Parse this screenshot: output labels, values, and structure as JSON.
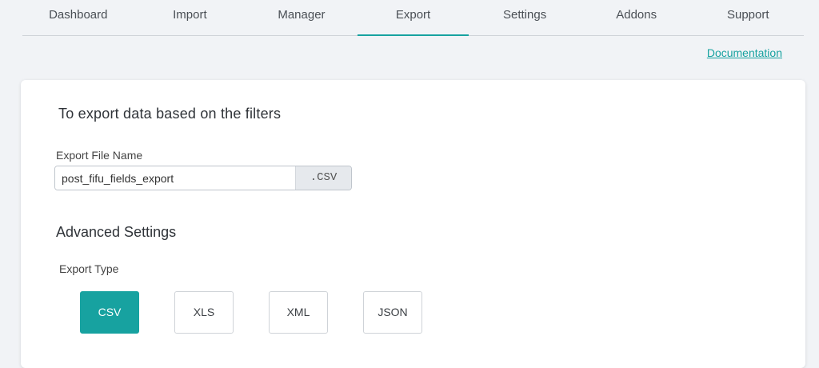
{
  "nav": {
    "tabs": [
      {
        "label": "Dashboard"
      },
      {
        "label": "Import"
      },
      {
        "label": "Manager"
      },
      {
        "label": "Export"
      },
      {
        "label": "Settings"
      },
      {
        "label": "Addons"
      },
      {
        "label": "Support"
      }
    ],
    "active_tab": "Export"
  },
  "documentation_link": "Documentation",
  "export": {
    "title": "To export data based on the filters",
    "file_name_label": "Export File Name",
    "file_name_value": "post_fifu_fields_export",
    "file_extension": ".CSV",
    "advanced_title": "Advanced Settings",
    "type_label": "Export Type",
    "types": [
      {
        "label": "CSV"
      },
      {
        "label": "XLS"
      },
      {
        "label": "XML"
      },
      {
        "label": "JSON"
      }
    ],
    "selected_type": "CSV"
  },
  "colors": {
    "accent": "#17a2a0",
    "background": "#f1f3f6",
    "card": "#ffffff"
  }
}
